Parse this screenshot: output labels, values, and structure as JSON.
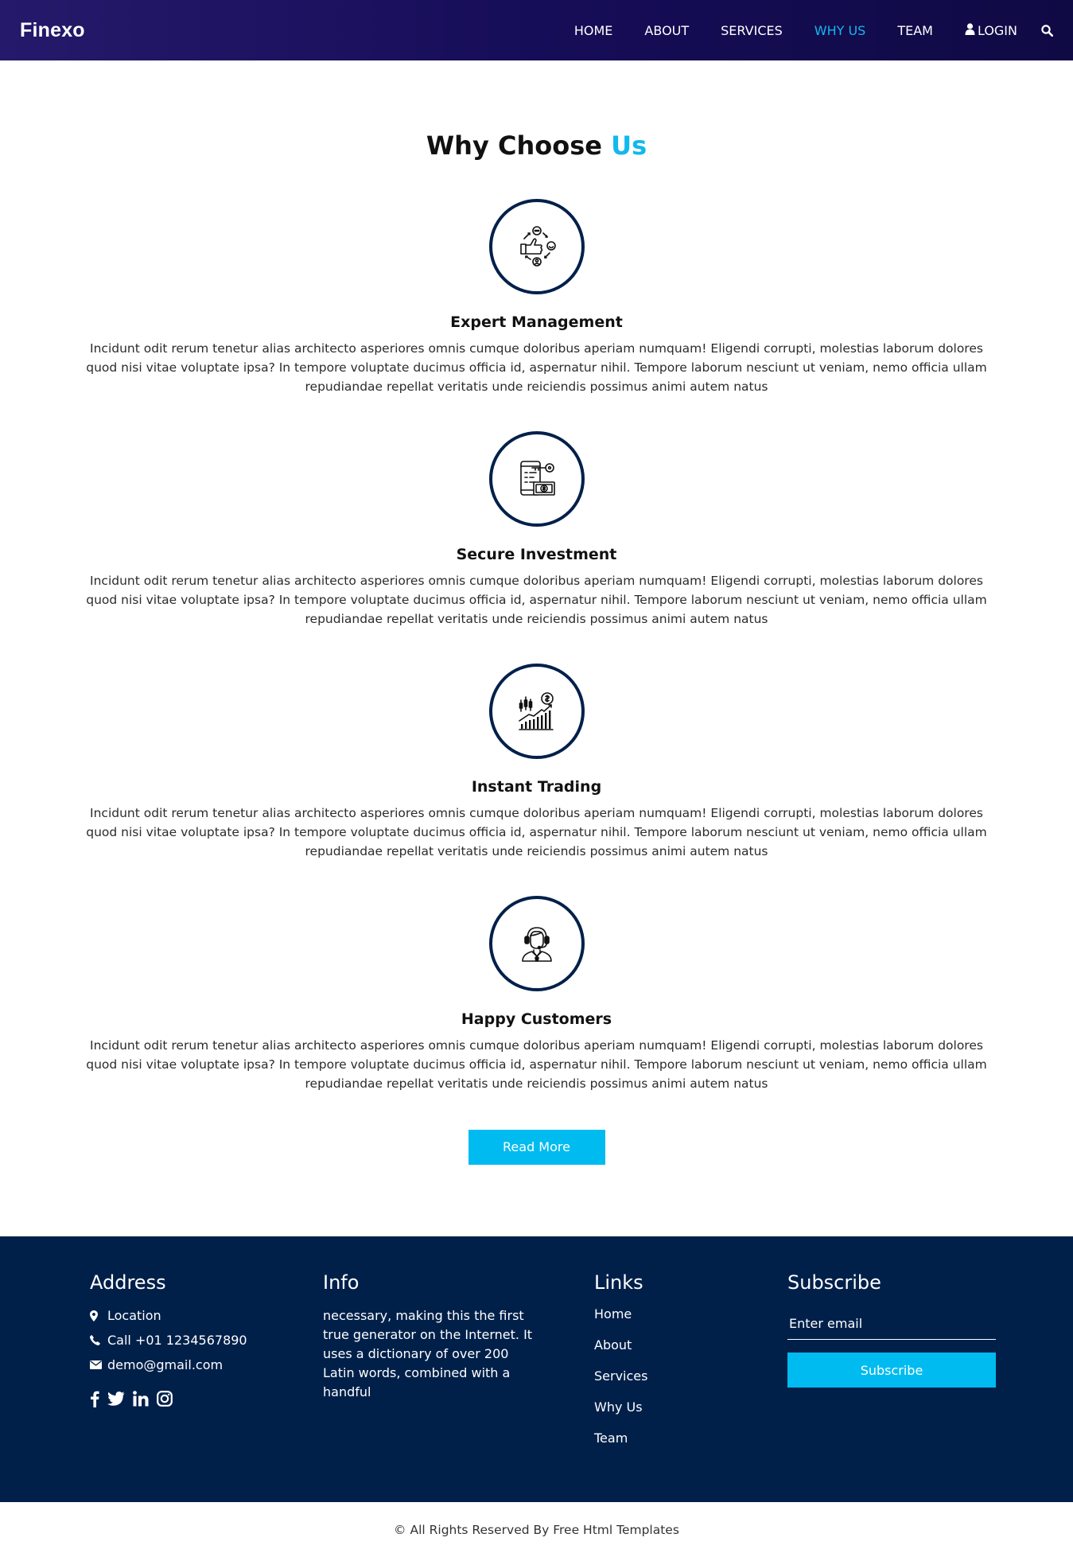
{
  "header": {
    "brand": "Finexo",
    "nav": [
      "HOME",
      "ABOUT",
      "SERVICES",
      "WHY US",
      "TEAM"
    ],
    "login_label": "LOGIN",
    "active_item": "WHY US",
    "accent_color": "#12b8ee"
  },
  "why": {
    "heading_main": "Why Choose",
    "heading_accent": "Us",
    "features": [
      {
        "title": "Expert Management",
        "icon": "management-icon",
        "text": "Incidunt odit rerum tenetur alias architecto asperiores omnis cumque doloribus aperiam numquam! Eligendi corrupti, molestias laborum dolores quod nisi vitae voluptate ipsa? In tempore voluptate ducimus officia id, aspernatur nihil. Tempore laborum nesciunt ut veniam, nemo officia ullam repudiandae repellat veritatis unde reiciendis possimus animi autem natus"
      },
      {
        "title": "Secure Investment",
        "icon": "secure-investment-icon",
        "text": "Incidunt odit rerum tenetur alias architecto asperiores omnis cumque doloribus aperiam numquam! Eligendi corrupti, molestias laborum dolores quod nisi vitae voluptate ipsa? In tempore voluptate ducimus officia id, aspernatur nihil. Tempore laborum nesciunt ut veniam, nemo officia ullam repudiandae repellat veritatis unde reiciendis possimus animi autem natus"
      },
      {
        "title": "Instant Trading",
        "icon": "trading-chart-icon",
        "text": "Incidunt odit rerum tenetur alias architecto asperiores omnis cumque doloribus aperiam numquam! Eligendi corrupti, molestias laborum dolores quod nisi vitae voluptate ipsa? In tempore voluptate ducimus officia id, aspernatur nihil. Tempore laborum nesciunt ut veniam, nemo officia ullam repudiandae repellat veritatis unde reiciendis possimus animi autem natus"
      },
      {
        "title": "Happy Customers",
        "icon": "customer-support-icon",
        "text": "Incidunt odit rerum tenetur alias architecto asperiores omnis cumque doloribus aperiam numquam! Eligendi corrupti, molestias laborum dolores quod nisi vitae voluptate ipsa? In tempore voluptate ducimus officia id, aspernatur nihil. Tempore laborum nesciunt ut veniam, nemo officia ullam repudiandae repellat veritatis unde reiciendis possimus animi autem natus"
      }
    ],
    "read_more": "Read More",
    "button_color": "#00bbf0"
  },
  "footer": {
    "address": {
      "heading": "Address",
      "location": "Location",
      "phone": "Call +01 1234567890",
      "email": "demo@gmail.com",
      "socials": [
        "facebook-icon",
        "twitter-icon",
        "linkedin-icon",
        "instagram-icon"
      ]
    },
    "info": {
      "heading": "Info",
      "text": "necessary, making this the first true generator on the Internet. It uses a dictionary of over 200 Latin words, combined with a handful"
    },
    "links": {
      "heading": "Links",
      "items": [
        "Home",
        "About",
        "Services",
        "Why Us",
        "Team"
      ]
    },
    "subscribe": {
      "heading": "Subscribe",
      "placeholder": "Enter email",
      "button": "Subscribe"
    },
    "background": "#00204a"
  },
  "copyright": "© All Rights Reserved By Free Html Templates"
}
